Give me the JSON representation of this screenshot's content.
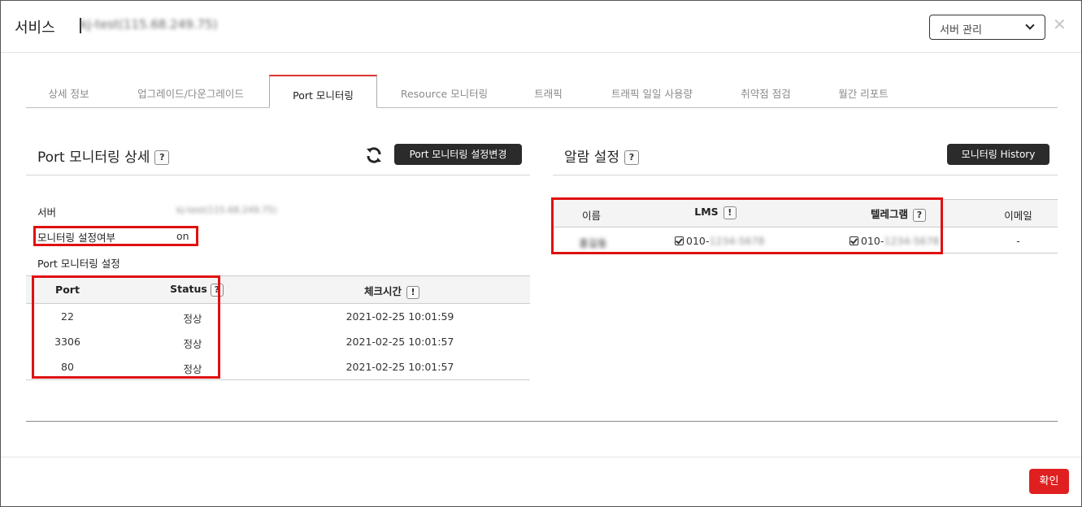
{
  "header": {
    "title": "서비스",
    "server_name": "kj-test(115.68.249.75)",
    "select_value": "서버 관리",
    "close_icon": "close-icon"
  },
  "tabs": [
    {
      "label": "상세 정보",
      "active": false
    },
    {
      "label": "업그레이드/다운그레이드",
      "active": false
    },
    {
      "label": "Port 모니터링",
      "active": true
    },
    {
      "label": "Resource 모니터링",
      "active": false
    },
    {
      "label": "트래픽",
      "active": false
    },
    {
      "label": "트래픽 일일 사용량",
      "active": false
    },
    {
      "label": "취약점 점검",
      "active": false
    },
    {
      "label": "월간 리포트",
      "active": false
    }
  ],
  "port_section": {
    "title": "Port 모니터링 상세",
    "help": "?",
    "settings_button": "Port 모니터링 설정변경",
    "server_label": "서버",
    "server_value": "kj-test(115.68.249.75)",
    "monitoring_label": "모니터링 설정여부",
    "monitoring_value": "on",
    "settings_label": "Port 모니터링 설정",
    "table": {
      "headers": {
        "port": "Port",
        "status": "Status",
        "check_time": "체크시간"
      },
      "status_help": "?",
      "check_time_info": "!",
      "rows": [
        {
          "port": "22",
          "status": "정상",
          "check_time": "2021-02-25 10:01:59"
        },
        {
          "port": "3306",
          "status": "정상",
          "check_time": "2021-02-25 10:01:57"
        },
        {
          "port": "80",
          "status": "정상",
          "check_time": "2021-02-25 10:01:57"
        }
      ]
    }
  },
  "alarm_section": {
    "title": "알람 설정",
    "help": "?",
    "history_button": "모니터링 History",
    "table": {
      "headers": {
        "name": "이름",
        "lms": "LMS",
        "telegram": "텔레그램",
        "email": "이메일"
      },
      "lms_info": "!",
      "telegram_help": "?",
      "rows": [
        {
          "name": "홍길동",
          "lms_prefix": "010-",
          "lms_rest": "1234-5678",
          "telegram_prefix": "010-",
          "telegram_rest": "1234-5678",
          "email": "-"
        }
      ]
    }
  },
  "footer": {
    "confirm_button": "확인"
  },
  "colors": {
    "accent_red": "#e02020",
    "highlight_box": "#e01010",
    "dark_button": "#2b2b2b"
  }
}
